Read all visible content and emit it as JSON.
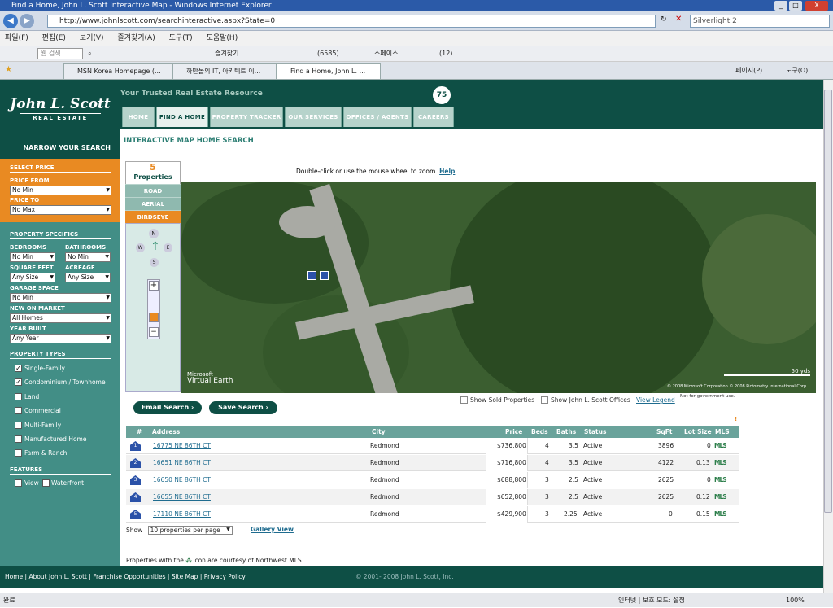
{
  "window": {
    "title": "Find a Home, John L. Scott Interactive Map - Windows Internet Explorer",
    "min": "_",
    "max": "□",
    "close": "X"
  },
  "address_bar": {
    "url": "http://www.johnlscott.com/searchinteractive.aspx?State=0",
    "search_value": "Silverlight 2"
  },
  "menu": [
    "파일(F)",
    "편집(E)",
    "보기(V)",
    "즐겨찾기(A)",
    "도구(T)",
    "도움말(H)"
  ],
  "toolbar": {
    "search_placeholder": "웹 검색...",
    "favorites": "즐겨찾기",
    "mail_count": "(6585)",
    "space": "스페이스",
    "count2": "(12)"
  },
  "browser_tabs": [
    "MSN Korea Homepage (...",
    "까만돌의 IT, 아키텍트 이...",
    "Find a Home, John L. ..."
  ],
  "browser_tools": {
    "page": "페이지(P)",
    "tools": "도구(O)"
  },
  "site": {
    "logo_name": "John L. Scott",
    "logo_sub": "REAL ESTATE",
    "tagline": "Your Trusted Real Estate Resource",
    "badge": "75",
    "tabs": [
      "HOME",
      "FIND A HOME",
      "PROPERTY TRACKER",
      "OUR SERVICES",
      "OFFICES / AGENTS",
      "CAREERS"
    ]
  },
  "sidebar": {
    "narrow": "NARROW YOUR SEARCH",
    "select_price": "SELECT PRICE",
    "price_from_label": "PRICE FROM",
    "price_from": "No Min",
    "price_to_label": "PRICE TO",
    "price_to": "No Max",
    "property_specifics": "PROPERTY SPECIFICS",
    "bedrooms_label": "BEDROOMS",
    "bedrooms": "No Min",
    "bathrooms_label": "BATHROOMS",
    "bathrooms": "No Min",
    "sqft_label": "SQUARE FEET",
    "sqft": "Any Size",
    "acreage_label": "ACREAGE",
    "acreage": "Any Size",
    "garage_label": "GARAGE SPACE",
    "garage": "No Min",
    "new_label": "NEW ON MARKET",
    "new": "All Homes",
    "year_label": "YEAR BUILT",
    "year": "Any Year",
    "types_label": "PROPERTY TYPES",
    "types": [
      {
        "label": "Single-Family",
        "checked": "✓"
      },
      {
        "label": "Condominium / Townhome",
        "checked": "✓"
      },
      {
        "label": "Land",
        "checked": ""
      },
      {
        "label": "Commercial",
        "checked": ""
      },
      {
        "label": "Multi-Family",
        "checked": ""
      },
      {
        "label": "Manufactured Home",
        "checked": ""
      },
      {
        "label": "Farm & Ranch",
        "checked": ""
      }
    ],
    "features_label": "FEATURES",
    "features": [
      {
        "label": "View"
      },
      {
        "label": "Waterfront"
      }
    ]
  },
  "content": {
    "title": "INTERACTIVE MAP HOME SEARCH",
    "prop_count": "5",
    "prop_label": "Properties",
    "map_modes": [
      "ROAD",
      "AERIAL",
      "BIRDSEYE"
    ],
    "zoom_hint": "Double-click or use the mouse wheel to zoom.",
    "help": "Help",
    "map_brand1": "Microsoft",
    "map_brand2": "Virtual Earth",
    "map_copyright": "© 2008 Microsoft Corporation   © 2008 Pictometry International Corp.",
    "scale": "50 yds",
    "compass": {
      "n": "N",
      "w": "W",
      "e": "E",
      "s": "S"
    },
    "email_btn": "Email Search ›",
    "save_btn": "Save Search ›",
    "show_sold": "Show Sold Properties",
    "show_offices": "Show John L. Scott Offices",
    "view_legend": "View Legend",
    "nogov": "Not for government use.",
    "marker": "!"
  },
  "table": {
    "headers": {
      "num": "#",
      "address": "Address",
      "city": "City",
      "price": "Price",
      "beds": "Beds",
      "baths": "Baths",
      "status": "Status",
      "sqft": "SqFt",
      "lot": "Lot Size",
      "mls": "MLS"
    },
    "rows": [
      {
        "n": "1",
        "address": "16775 NE 86TH CT",
        "city": "Redmond",
        "price": "$736,800",
        "beds": "4",
        "baths": "3.5",
        "status": "Active",
        "sqft": "3896",
        "lot": "0",
        "mls": "MLS"
      },
      {
        "n": "2",
        "address": "16651 NE 86TH CT",
        "city": "Redmond",
        "price": "$716,800",
        "beds": "4",
        "baths": "3.5",
        "status": "Active",
        "sqft": "4122",
        "lot": "0.13",
        "mls": "MLS"
      },
      {
        "n": "3",
        "address": "16650 NE 86TH CT",
        "city": "Redmond",
        "price": "$688,800",
        "beds": "3",
        "baths": "2.5",
        "status": "Active",
        "sqft": "2625",
        "lot": "0",
        "mls": "MLS"
      },
      {
        "n": "4",
        "address": "16655 NE 86TH CT",
        "city": "Redmond",
        "price": "$652,800",
        "beds": "3",
        "baths": "2.5",
        "status": "Active",
        "sqft": "2625",
        "lot": "0.12",
        "mls": "MLS"
      },
      {
        "n": "5",
        "address": "17110 NE 86TH CT",
        "city": "Redmond",
        "price": "$429,900",
        "beds": "3",
        "baths": "2.25",
        "status": "Active",
        "sqft": "0",
        "lot": "0.15",
        "mls": "MLS"
      }
    ]
  },
  "below": {
    "show": "Show",
    "per_page": "10 properties per page",
    "gallery": "Gallery View",
    "note_pre": "Properties with the",
    "note_post": "icon are courtesy of Northwest MLS."
  },
  "footer": {
    "links": "Home | About John L. Scott | Franchise Opportunities | Site Map | Privacy Policy",
    "copyright": "© 2001- 2008 John L. Scott, Inc."
  },
  "status": {
    "left": "완료",
    "zone": "인터넷 | 보호 모드: 설정",
    "zoom": "100%"
  }
}
